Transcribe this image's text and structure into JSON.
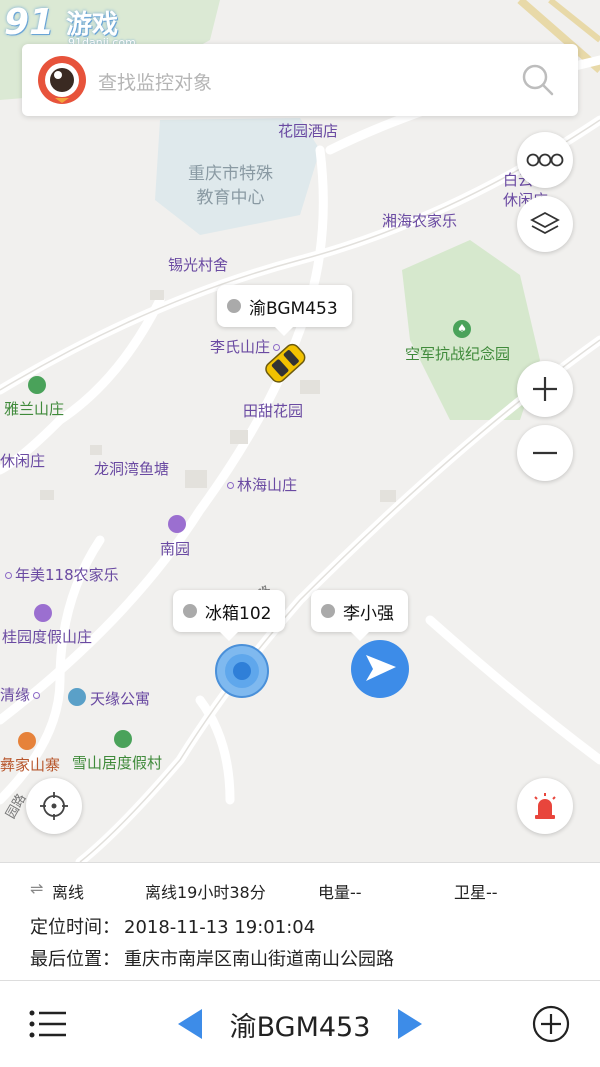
{
  "watermark": {
    "brand": "91",
    "brand_cn": "游戏",
    "url": "91danji.com"
  },
  "search": {
    "placeholder": "查找监控对象"
  },
  "map": {
    "pois": {
      "hotel": "花园酒店",
      "school": "重庆市特殊\n教育中心",
      "xiguang": "锡光村舍",
      "xianghai": "湘海农家乐",
      "baiyun": "白云山\n休闲庄",
      "memorial": "空军抗战纪念园",
      "lishi": "李氏山庄",
      "tiantian": "田甜花园",
      "yalan": "雅兰山庄",
      "xianzhuang": "休闲庄",
      "longdong": "龙洞湾鱼塘",
      "linhai": "林海山庄",
      "nanyuan": "南园",
      "nianmei": "年美118农家乐",
      "guiyuan": "桂园度假山庄",
      "qingxiu": "清缘",
      "tianyuan": "天缘公寓",
      "xueshan": "雪山居度假村",
      "yijia": "彝家山寨",
      "road1": "南山公园路",
      "road2": "园路"
    },
    "markers": [
      {
        "label": "渝BGM453",
        "kind": "car"
      },
      {
        "label": "冰箱102",
        "kind": "circle"
      },
      {
        "label": "李小强",
        "kind": "arrow"
      }
    ]
  },
  "info": {
    "status": "离线",
    "duration": "离线19小时38分",
    "battery": "电量--",
    "satellite": "卫星--",
    "location_time_label": "定位时间：",
    "location_time": "2018-11-13 19:01:04",
    "last_position_label": "最后位置：",
    "last_position": "重庆市南岸区南山街道南山公园路"
  },
  "bottom": {
    "plate": "渝BGM453"
  },
  "colors": {
    "accent": "#3d8ce8",
    "alarm": "#e8453c",
    "status_gray": "#aaaaaa",
    "park_green": "#d7ead1",
    "water": "#dde9ee"
  }
}
